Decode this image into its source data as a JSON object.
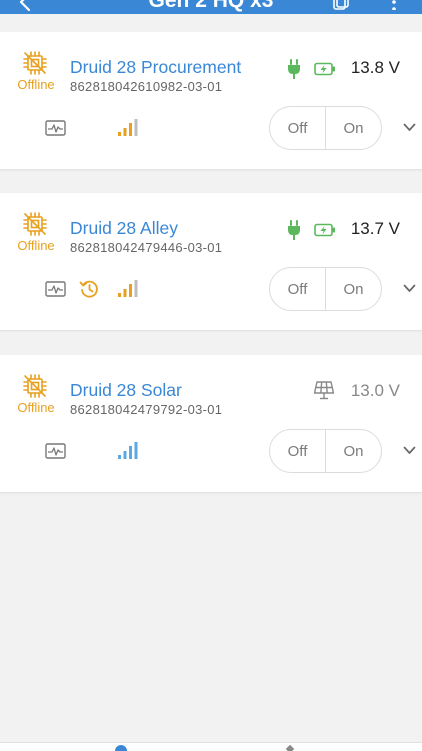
{
  "header": {
    "title": "Gen 2 HQ x3"
  },
  "colors": {
    "accent": "#3a87d6",
    "offline": "#e8a020",
    "power_ok": "#5cb85c",
    "signal_blue": "#5aa9e6"
  },
  "devices": [
    {
      "name": "Druid 28 Procurement",
      "serial": "862818042610982-03-01",
      "status": "Offline",
      "voltage": "13.8 V",
      "power_source": "plug-icon",
      "toggle_off": "Off",
      "toggle_on": "On"
    },
    {
      "name": "Druid 28 Alley",
      "serial": "862818042479446-03-01",
      "status": "Offline",
      "voltage": "13.7 V",
      "power_source": "plug-icon",
      "toggle_off": "Off",
      "toggle_on": "On"
    },
    {
      "name": "Druid 28 Solar",
      "serial": "862818042479792-03-01",
      "status": "Offline",
      "voltage": "13.0 V",
      "power_source": "solar-panel-icon",
      "toggle_off": "Off",
      "toggle_on": "On"
    }
  ]
}
